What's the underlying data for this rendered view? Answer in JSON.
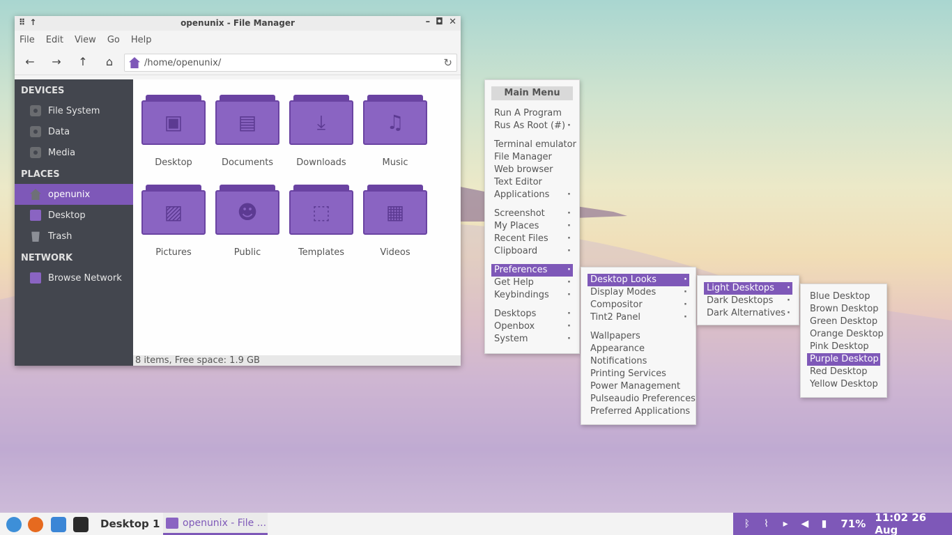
{
  "window": {
    "title": "openunix - File Manager",
    "menu": [
      "File",
      "Edit",
      "View",
      "Go",
      "Help"
    ],
    "location": "/home/openunix/",
    "sidebar": {
      "devices_header": "DEVICES",
      "devices": [
        "File System",
        "Data",
        "Media"
      ],
      "places_header": "PLACES",
      "places": [
        "openunix",
        "Desktop",
        "Trash"
      ],
      "network_header": "NETWORK",
      "network": [
        "Browse Network"
      ]
    },
    "folders": [
      "Desktop",
      "Documents",
      "Downloads",
      "Music",
      "Pictures",
      "Public",
      "Templates",
      "Videos"
    ],
    "status": "8 items, Free space: 1.9 GB"
  },
  "main_menu": {
    "title": "Main Menu",
    "items": [
      "Run A Program",
      "Rus As Root (#)",
      "Terminal emulator",
      "File Manager",
      "Web browser",
      "Text Editor",
      "Applications",
      "Screenshot",
      "My Places",
      "Recent Files",
      "Clipboard",
      "Preferences",
      "Get Help",
      "Keybindings",
      "Desktops",
      "Openbox",
      "System"
    ]
  },
  "preferences_menu": {
    "items": [
      "Desktop Looks",
      "Display Modes",
      "Compositor",
      "Tint2 Panel",
      "Wallpapers",
      "Appearance",
      "Notifications",
      "Printing Services",
      "Power Management",
      "Pulseaudio Preferences",
      "Preferred Applications"
    ]
  },
  "looks_menu": {
    "items": [
      "Light Desktops",
      "Dark Desktops",
      "Dark Alternatives"
    ]
  },
  "light_menu": {
    "items": [
      "Blue Desktop",
      "Brown Desktop",
      "Green Desktop",
      "Orange Desktop",
      "Pink Desktop",
      "Purple Desktop",
      "Red Desktop",
      "Yellow Desktop"
    ]
  },
  "taskbar": {
    "desktop": "Desktop 1",
    "task": "openunix - File ...",
    "battery": "71%",
    "clock": "11:02 26 Aug"
  },
  "colors": {
    "accent": "#7e58b8",
    "sidebar": "#43464e"
  }
}
